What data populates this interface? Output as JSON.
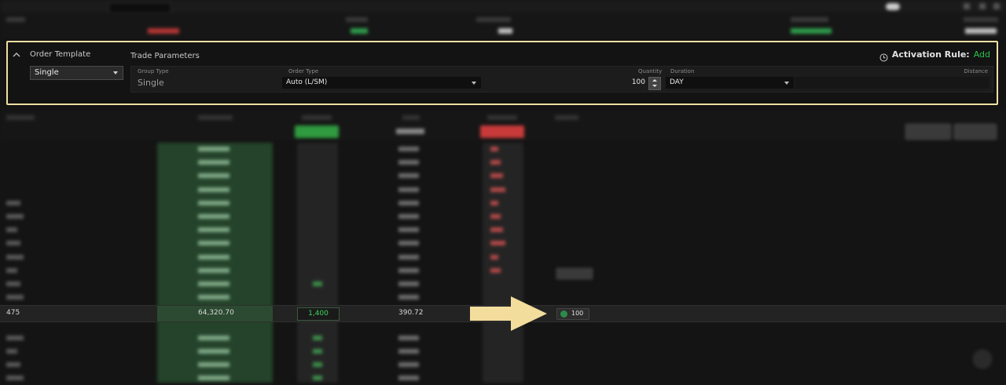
{
  "order_panel": {
    "order_template_label": "Order Template",
    "order_template_value": "Single",
    "trade_parameters_label": "Trade Parameters",
    "activation_rule_label": "Activation Rule:",
    "activation_rule_add": "Add",
    "fields": {
      "group_type_label": "Group Type",
      "group_type_value": "Single",
      "order_type_label": "Order Type",
      "order_type_value": "Auto (L/SM)",
      "quantity_label": "Quantity",
      "quantity_value": "100",
      "duration_label": "Duration",
      "duration_value": "DAY",
      "distance_label": "Distance"
    }
  },
  "ladder": {
    "current_row": {
      "volume": "475",
      "price": "64,320.70",
      "buy_size": "1,400",
      "mark": "390.72",
      "order_qty": "100"
    }
  },
  "colors": {
    "highlight_border": "#f0dfa2",
    "arrow": "#f3dd9d",
    "add_link": "#27c14a",
    "buy_size": "#3fd65c",
    "green_column": "#24432a"
  }
}
